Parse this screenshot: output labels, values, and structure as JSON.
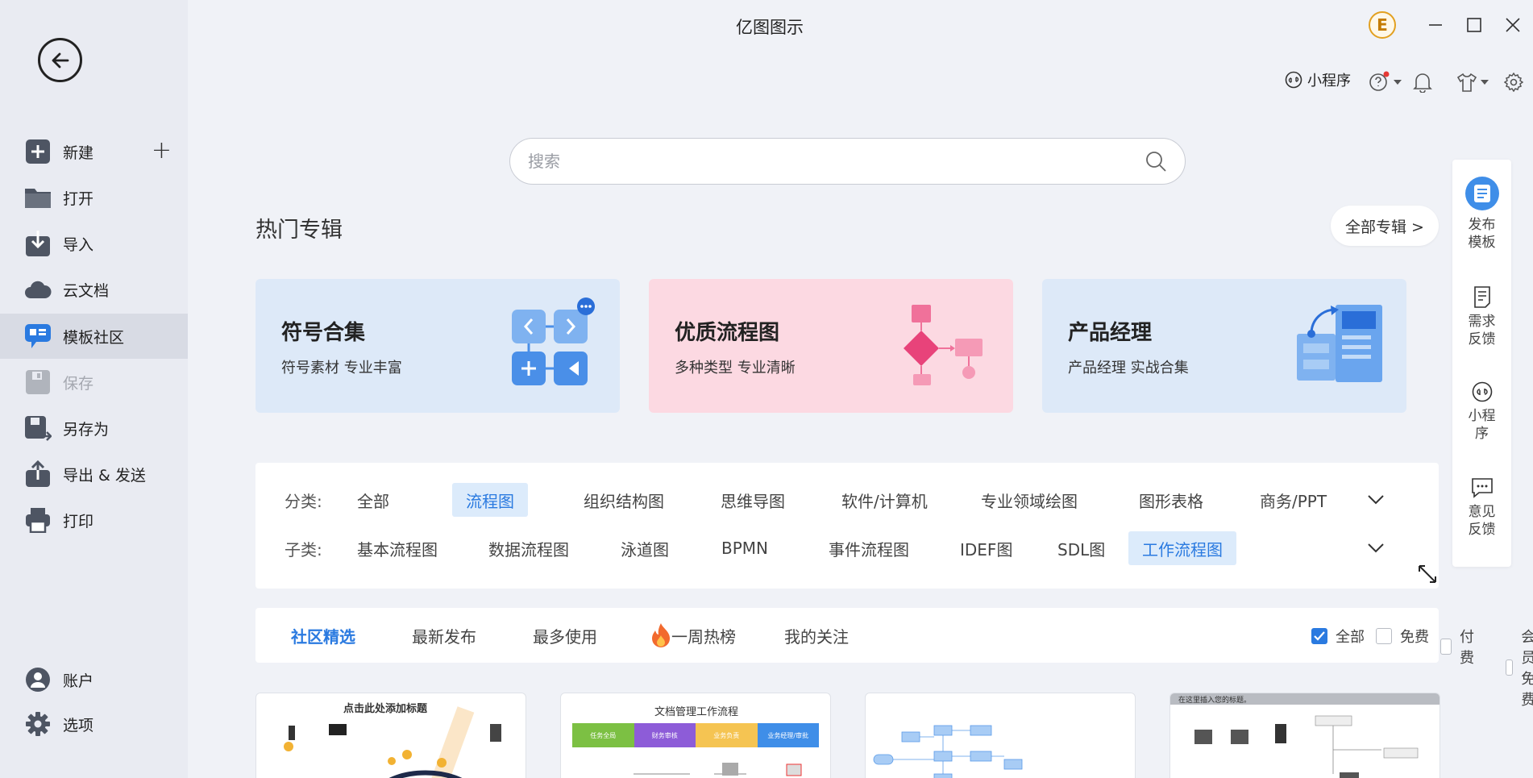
{
  "app": {
    "title": "亿图图示"
  },
  "sidebar": {
    "back_icon": "back-arrow-icon",
    "items": [
      {
        "label": "新建",
        "icon": "new-file-icon"
      },
      {
        "label": "打开",
        "icon": "folder-icon"
      },
      {
        "label": "导入",
        "icon": "import-icon"
      },
      {
        "label": "云文档",
        "icon": "cloud-icon"
      },
      {
        "label": "模板社区",
        "icon": "template-community-icon",
        "active": true
      },
      {
        "label": "保存",
        "icon": "save-icon",
        "disabled": true
      },
      {
        "label": "另存为",
        "icon": "save-as-icon"
      },
      {
        "label": "导出 & 发送",
        "icon": "export-icon"
      },
      {
        "label": "打印",
        "icon": "print-icon"
      },
      {
        "label": "账户",
        "icon": "account-icon"
      },
      {
        "label": "选项",
        "icon": "settings-icon"
      }
    ]
  },
  "header": {
    "avatar_letter": "E",
    "mini_program": "小程序"
  },
  "search": {
    "placeholder": "搜索"
  },
  "hot": {
    "title": "热门专辑",
    "all_button": "全部专辑 >",
    "albums": [
      {
        "title": "符号合集",
        "subtitle": "符号素材 专业丰富",
        "bg": "#dde9f8"
      },
      {
        "title": "优质流程图",
        "subtitle": "多种类型 专业清晰",
        "bg": "#fcd9e2"
      },
      {
        "title": "产品经理",
        "subtitle": "产品经理 实战合集",
        "bg": "#dde9f8"
      }
    ]
  },
  "filters": {
    "category_label": "分类:",
    "categories": [
      "全部",
      "流程图",
      "组织结构图",
      "思维导图",
      "软件/计算机",
      "专业领域绘图",
      "图形表格",
      "商务/PPT"
    ],
    "selected_category": "流程图",
    "subcategory_label": "子类:",
    "subcategories": [
      "基本流程图",
      "数据流程图",
      "泳道图",
      "BPMN",
      "事件流程图",
      "IDEF图",
      "SDL图",
      "工作流程图"
    ],
    "selected_subcategory": "工作流程图"
  },
  "tabs": {
    "items": [
      "社区精选",
      "最新发布",
      "最多使用",
      "一周热榜",
      "我的关注"
    ],
    "active": "社区精选",
    "checks": [
      {
        "label": "全部",
        "checked": true
      },
      {
        "label": "免费",
        "checked": false
      },
      {
        "label": "付费",
        "checked": false
      },
      {
        "label": "会员免费",
        "checked": false
      }
    ]
  },
  "thumbnails": [
    {
      "title": "点击此处添加标题"
    },
    {
      "title": "文档管理工作流程",
      "lanes": [
        "任务全局",
        "财务审核",
        "业务负责",
        "业务经理/审批"
      ]
    },
    {
      "title": ""
    },
    {
      "title": "在这里插入您的标题。"
    }
  ],
  "right_bar": {
    "items": [
      "发布模板",
      "需求反馈",
      "小程序",
      "意见反馈"
    ]
  },
  "colors": {
    "accent": "#2a7ae0",
    "pink": "#fcd9e2",
    "lightblue": "#dde9f8"
  }
}
